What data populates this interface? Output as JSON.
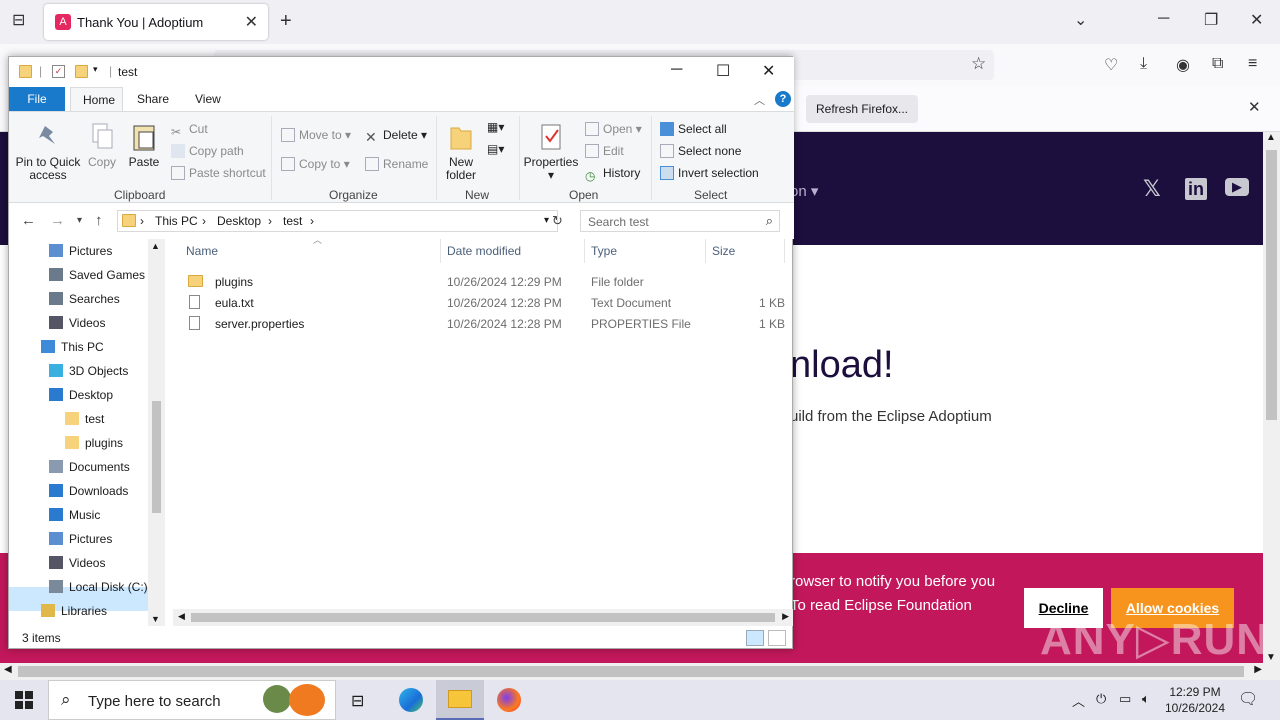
{
  "browser": {
    "tab_title": "Thank You | Adoptium",
    "tab_close": "✕",
    "new_tab": "+",
    "refresh_button": "Refresh Firefox...",
    "page": {
      "nav_fragment": "on ▾",
      "heading_fragment": "nload!",
      "sub_fragment": "uild from the Eclipse Adoptium",
      "cookie_text_line1": "rowser to notify you before you",
      "cookie_text_line2": "To read Eclipse Foundation",
      "decline": "Decline",
      "allow": "Allow cookies"
    },
    "watermark": "ANY▷RUN"
  },
  "explorer": {
    "title": "test",
    "ribbon_tabs": [
      "File",
      "Home",
      "Share",
      "View"
    ],
    "clipboard": {
      "pin": "Pin to Quick access",
      "copy": "Copy",
      "paste": "Paste",
      "cut": "Cut",
      "copy_path": "Copy path",
      "paste_shortcut": "Paste shortcut",
      "label": "Clipboard"
    },
    "organize": {
      "move_to": "Move to",
      "copy_to": "Copy to",
      "delete": "Delete",
      "rename": "Rename",
      "label": "Organize"
    },
    "new": {
      "new_folder": "New folder",
      "label": "New"
    },
    "open": {
      "properties": "Properties",
      "open": "Open",
      "edit": "Edit",
      "history": "History",
      "label": "Open"
    },
    "select": {
      "select_all": "Select all",
      "select_none": "Select none",
      "invert": "Invert selection",
      "label": "Select"
    },
    "breadcrumb": [
      "This PC",
      "Desktop",
      "test"
    ],
    "search_placeholder": "Search test",
    "nav_items": [
      {
        "label": "Pictures",
        "icon": "pictures-icon"
      },
      {
        "label": "Saved Games",
        "icon": "saved-games-icon"
      },
      {
        "label": "Searches",
        "icon": "searches-icon"
      },
      {
        "label": "Videos",
        "icon": "videos-icon"
      },
      {
        "label": "This PC",
        "icon": "pc-icon"
      },
      {
        "label": "3D Objects",
        "icon": "3d-objects-icon"
      },
      {
        "label": "Desktop",
        "icon": "desktop-icon"
      },
      {
        "label": "test",
        "icon": "folder-icon"
      },
      {
        "label": "plugins",
        "icon": "folder-icon"
      },
      {
        "label": "Documents",
        "icon": "documents-icon"
      },
      {
        "label": "Downloads",
        "icon": "downloads-icon"
      },
      {
        "label": "Music",
        "icon": "music-icon"
      },
      {
        "label": "Pictures",
        "icon": "pictures-icon"
      },
      {
        "label": "Videos",
        "icon": "videos-icon"
      },
      {
        "label": "Local Disk (C:)",
        "icon": "disk-icon"
      },
      {
        "label": "Libraries",
        "icon": "libraries-icon"
      }
    ],
    "columns": [
      "Name",
      "Date modified",
      "Type",
      "Size"
    ],
    "files": [
      {
        "name": "plugins",
        "date": "10/26/2024 12:29 PM",
        "type": "File folder",
        "size": ""
      },
      {
        "name": "eula.txt",
        "date": "10/26/2024 12:28 PM",
        "type": "Text Document",
        "size": "1 KB"
      },
      {
        "name": "server.properties",
        "date": "10/26/2024 12:28 PM",
        "type": "PROPERTIES File",
        "size": "1 KB"
      }
    ],
    "status_count": "3 items"
  },
  "taskbar": {
    "search_placeholder": "Type here to search",
    "time": "12:29 PM",
    "date": "10/26/2024"
  },
  "colors": {
    "accent": "#1979ca",
    "site_header": "#1c0e3d",
    "cookie_banner": "#c2185b",
    "allow_button": "#f7941e"
  }
}
